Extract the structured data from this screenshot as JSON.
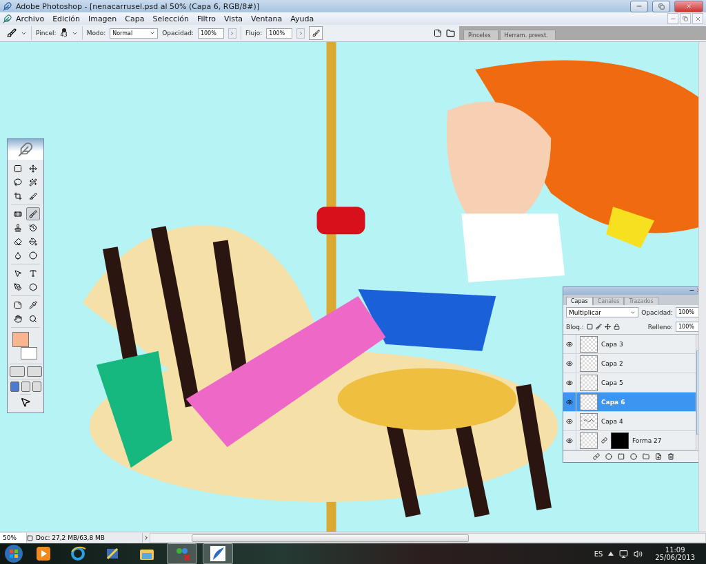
{
  "window": {
    "title": "Adobe Photoshop - [nenacarrusel.psd al 50% (Capa 6, RGB/8#)]"
  },
  "menu": [
    "Archivo",
    "Edición",
    "Imagen",
    "Capa",
    "Selección",
    "Filtro",
    "Vista",
    "Ventana",
    "Ayuda"
  ],
  "options_bar": {
    "brush_label": "Pincel:",
    "brush_size": "43",
    "mode_label": "Modo:",
    "mode": "Normal",
    "opacity_label": "Opacidad:",
    "opacity": "100%",
    "flow_label": "Flujo:",
    "flow": "100%"
  },
  "palette_well": {
    "tabs": [
      "Pinceles",
      "Herram. preest."
    ]
  },
  "tools": [
    {
      "selected": false
    },
    {
      "selected": false
    },
    {
      "selected": false
    },
    {
      "selected": false
    },
    {
      "selected": false
    },
    {
      "selected": false
    },
    {
      "selected": false
    },
    {
      "selected": true
    },
    {
      "selected": false
    },
    {
      "selected": false
    },
    {
      "selected": false
    },
    {
      "selected": false
    },
    {
      "selected": false
    },
    {
      "selected": false
    },
    {
      "selected": false
    },
    {
      "selected": false
    },
    {
      "selected": false
    },
    {
      "selected": false
    },
    {
      "selected": false
    },
    {
      "selected": false
    },
    {
      "selected": false
    },
    {
      "selected": false
    }
  ],
  "layers_panel": {
    "tabs": [
      {
        "label": "Capas",
        "selected": true
      },
      {
        "label": "Canales",
        "selected": false
      },
      {
        "label": "Trazados",
        "selected": false
      }
    ],
    "blend_mode": "Multiplicar",
    "opacity_label": "Opacidad:",
    "opacity": "100%",
    "lock_label": "Bloq.:",
    "fill_label": "Relleno:",
    "fill": "100%",
    "layers": [
      {
        "name": "Capa 3",
        "visible": true,
        "selected": false,
        "kind": "plain"
      },
      {
        "name": "Capa 2",
        "visible": true,
        "selected": false,
        "kind": "plain"
      },
      {
        "name": "Capa 5",
        "visible": true,
        "selected": false,
        "kind": "plain"
      },
      {
        "name": "Capa 6",
        "visible": true,
        "selected": true,
        "kind": "plain"
      },
      {
        "name": "Capa 4",
        "visible": true,
        "selected": false,
        "kind": "sketch"
      },
      {
        "name": "Forma 27",
        "visible": true,
        "selected": false,
        "kind": "masked"
      }
    ]
  },
  "status_bar": {
    "zoom": "50%",
    "doc": "Doc: 27,2 MB/63,8 MB"
  },
  "taskbar": {
    "language": "ES",
    "time": "11:09",
    "date": "25/06/2013"
  }
}
